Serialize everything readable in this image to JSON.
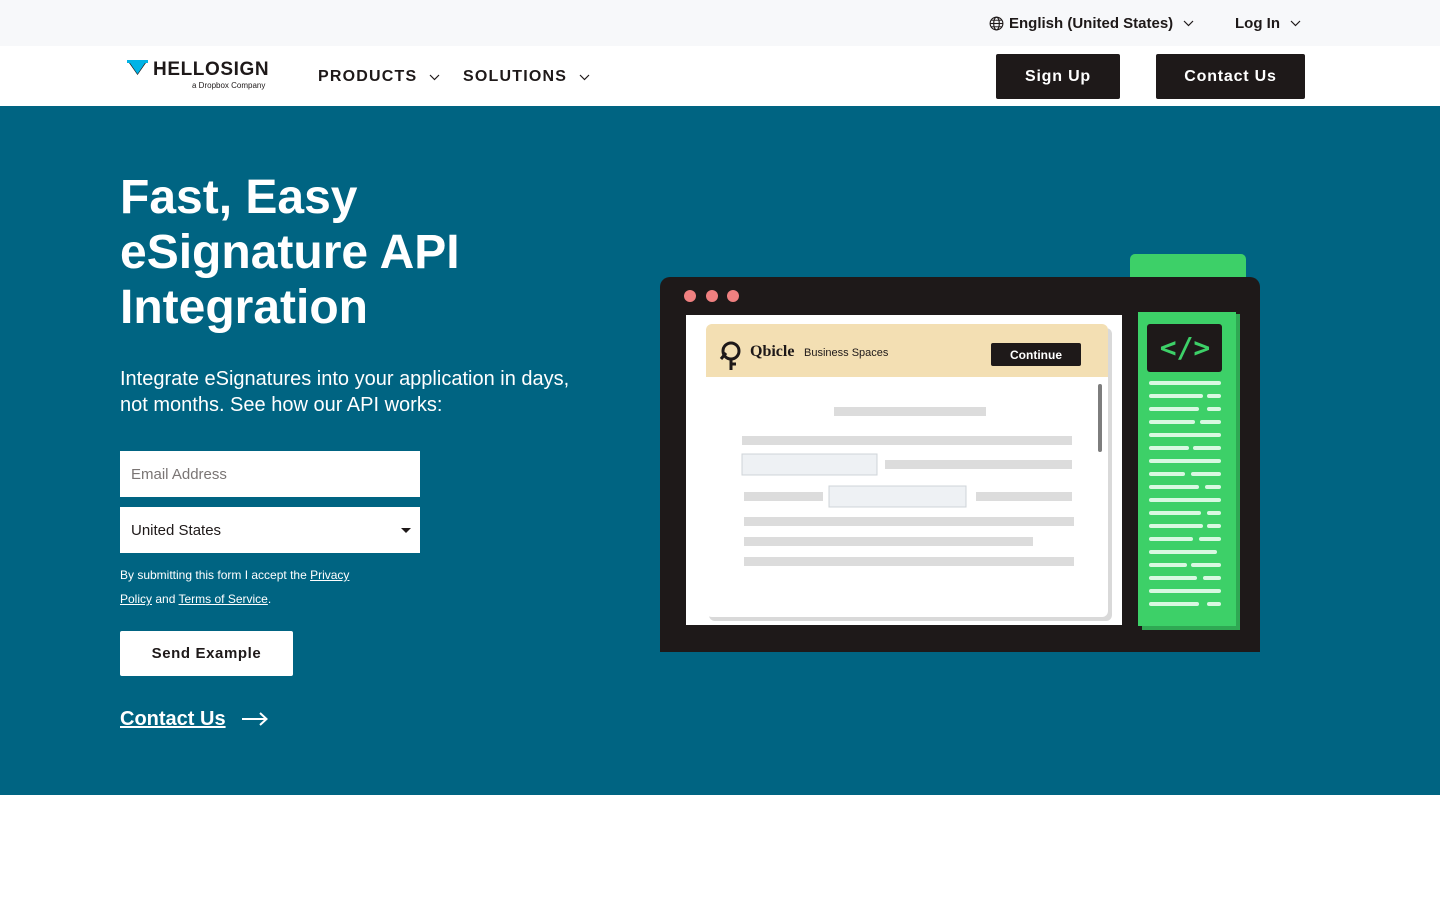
{
  "utility_bar": {
    "language": "English (United States)",
    "login": "Log In"
  },
  "nav": {
    "logo_word": "HELLOSIGN",
    "logo_sub": "a Dropbox Company",
    "products": "PRODUCTS",
    "solutions": "SOLUTIONS",
    "sign_up": "Sign Up",
    "contact_us": "Contact Us"
  },
  "hero": {
    "title": "Fast, Easy eSignature API Integration",
    "subtitle": "Integrate eSignatures into your application in days, not months. See how our API works:",
    "email_placeholder": "Email Address",
    "country_value": "United States",
    "legal_prefix": "By submitting this form I accept the ",
    "privacy_link": "Privacy Policy",
    "legal_and": " and ",
    "terms_link": "Terms of Service",
    "legal_suffix": ".",
    "send_button": "Send Example",
    "contact_link": "Contact Us"
  },
  "illustration": {
    "brand_name": "Qbicle",
    "brand_tag": "Business Spaces",
    "continue_button": "Continue",
    "code_symbol": "</>"
  },
  "colors": {
    "hero_bg": "#006482",
    "dark": "#1e1919",
    "green": "#3dd068",
    "tan": "#f3dfb3",
    "dot": "#f08080"
  },
  "icons": [
    "globe-icon",
    "chevron-down-icon",
    "arrow-right-icon",
    "key-icon"
  ]
}
